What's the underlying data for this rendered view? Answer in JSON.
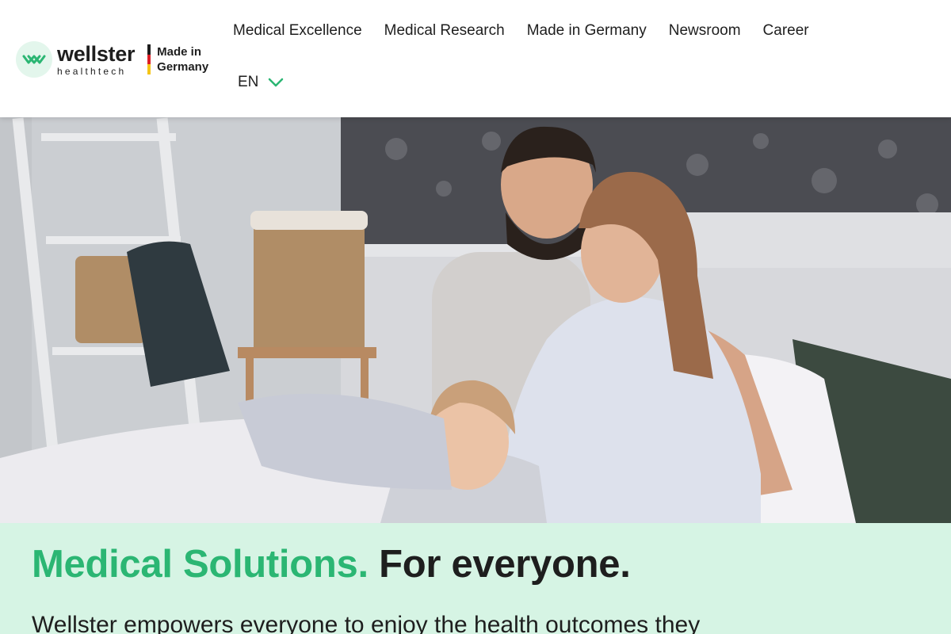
{
  "brand": {
    "name": "wellster",
    "subtitle": "healthtech",
    "badge": "Made in Germany",
    "colors": {
      "accent": "#2bb673",
      "text": "#1e1e1e",
      "section_bg": "#d6f4e4"
    }
  },
  "nav": {
    "items": [
      {
        "label": "Medical Excellence"
      },
      {
        "label": "Medical Research"
      },
      {
        "label": "Made in Germany"
      },
      {
        "label": "Newsroom"
      },
      {
        "label": "Career"
      }
    ],
    "language": {
      "selected": "EN",
      "icon": "chevron-down-icon"
    }
  },
  "hero": {
    "icon": "family-photo"
  },
  "intro": {
    "headline_accent": "Medical Solutions.",
    "headline_rest": "For everyone.",
    "lead": "Wellster empowers everyone to enjoy the health outcomes they"
  }
}
